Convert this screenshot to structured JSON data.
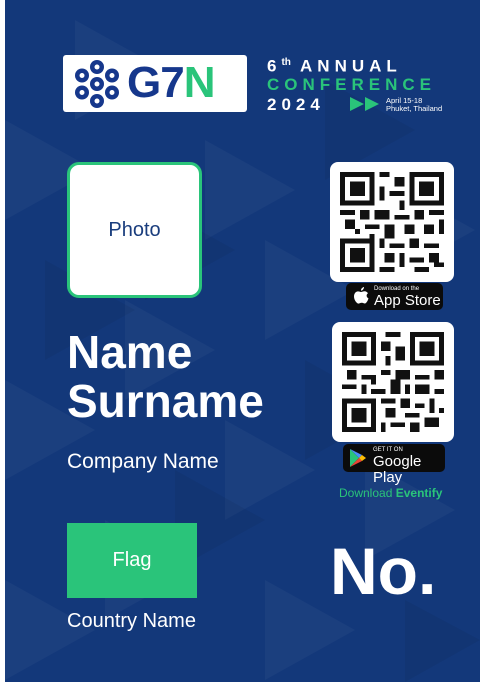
{
  "logo": {
    "text_g7": "G7",
    "text_n": "N",
    "colors": {
      "navy": "#16378c",
      "green": "#2ac47a"
    },
    "icon": "molecule-hexagon-icon"
  },
  "conference": {
    "ordinal": "6",
    "ordinal_suffix": "th",
    "annual": "ANNUAL",
    "conference": "CONFERENCE",
    "year": "2024",
    "date_line1": "April 15-18",
    "date_line2": "Phuket, Thailand",
    "arrow_icon": "double-play-arrow-icon"
  },
  "photo": {
    "label": "Photo"
  },
  "name": {
    "line1": "Name",
    "line2": "Surname"
  },
  "company": "Company Name",
  "flag": {
    "label": "Flag"
  },
  "country": "Country Name",
  "number_label": "No.",
  "apps": {
    "app_store_small": "Download on the",
    "app_store_big": "App Store",
    "google_small": "GET IT ON",
    "google_big": "Google Play",
    "download_prefix": "Download",
    "download_brand": "Eventify"
  },
  "colors": {
    "background": "#13387a",
    "accent": "#2ac47a",
    "text": "#ffffff"
  }
}
